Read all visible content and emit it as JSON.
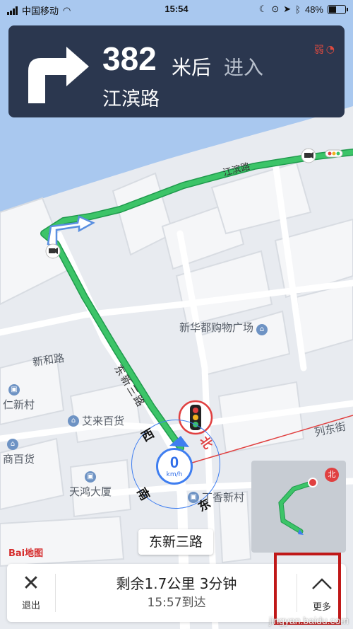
{
  "status_bar": {
    "carrier": "中国移动",
    "time": "15:54",
    "battery_text": "48%",
    "battery_level": 0.48
  },
  "guidance": {
    "turn_icon": "turn-right-arrow-icon",
    "distance": "382",
    "unit": "米后",
    "action": "进入",
    "road": "江滨路",
    "signal_text": "弱"
  },
  "map": {
    "road_labels": [
      "江滨路",
      "东新三路",
      "新和路",
      "列东街"
    ],
    "pois": [
      "新华都购物广场",
      "艾来百货",
      "天鸿大厦",
      "丁香新村",
      "仁新村",
      "商百货"
    ],
    "compass": {
      "west": "西",
      "north": "北",
      "south": "南",
      "east": "东"
    },
    "speed": {
      "value": "0",
      "unit": "km/h"
    },
    "current_road": "东新三路",
    "logo": "Bai地图",
    "route_color": "#3cc468",
    "water_color": "#a9c8ef"
  },
  "bottom_bar": {
    "exit_label": "退出",
    "remaining": "剩余1.7公里 3分钟",
    "arrival": "15:57到达",
    "more_label": "更多"
  },
  "watermark": "jingyan.baidu.com"
}
